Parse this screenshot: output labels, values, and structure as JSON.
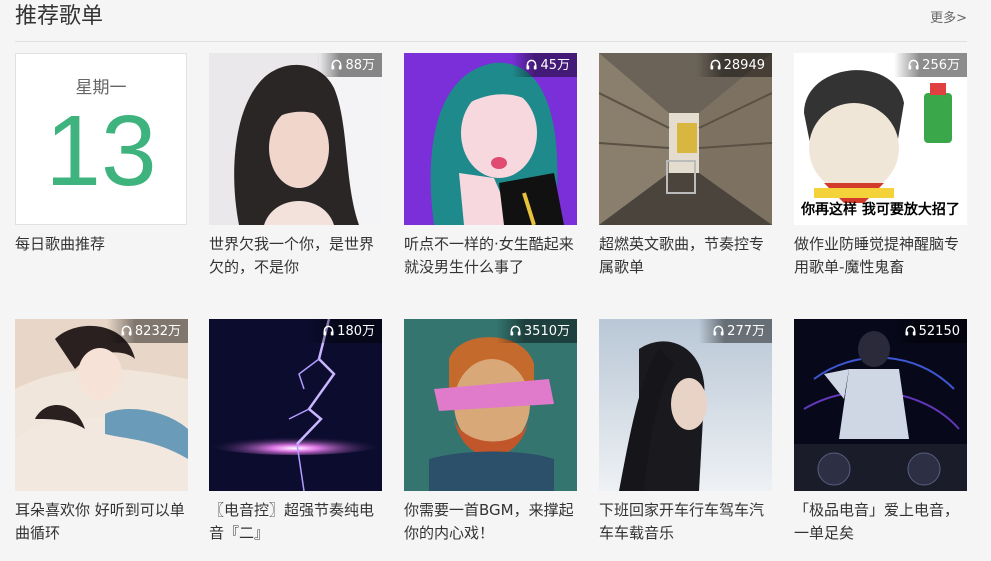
{
  "header": {
    "title": "推荐歌单",
    "more_label": "更多>"
  },
  "daily": {
    "weekday": "星期一",
    "day": "13",
    "title": "每日歌曲推荐"
  },
  "icons": {
    "play_count": "headphones-icon"
  },
  "colors": {
    "accent": "#3eb37e"
  },
  "playlists": [
    {
      "title": "世界欠我一个你，是世界欠的，不是你",
      "plays": "88万"
    },
    {
      "title": "听点不一样的·女生酷起来就没男生什么事了",
      "plays": "45万"
    },
    {
      "title": "超燃英文歌曲，节奏控专属歌单",
      "plays": "28949"
    },
    {
      "title": "做作业防睡觉提神醒脑专用歌单-魔性鬼畜",
      "plays": "256万",
      "cover_text": "你再这样 我可要放大招了"
    },
    {
      "title": "耳朵喜欢你 好听到可以单曲循环",
      "plays": "8232万"
    },
    {
      "title": "〖电音控〗超强节奏纯电音『二』",
      "plays": "180万"
    },
    {
      "title": "你需要一首BGM，来撑起你的内心戏！",
      "plays": "3510万"
    },
    {
      "title": "下班回家开车行车驾车汽车车载音乐",
      "plays": "277万"
    },
    {
      "title": "「极品电音」爱上电音，一单足矣",
      "plays": "52150"
    }
  ]
}
